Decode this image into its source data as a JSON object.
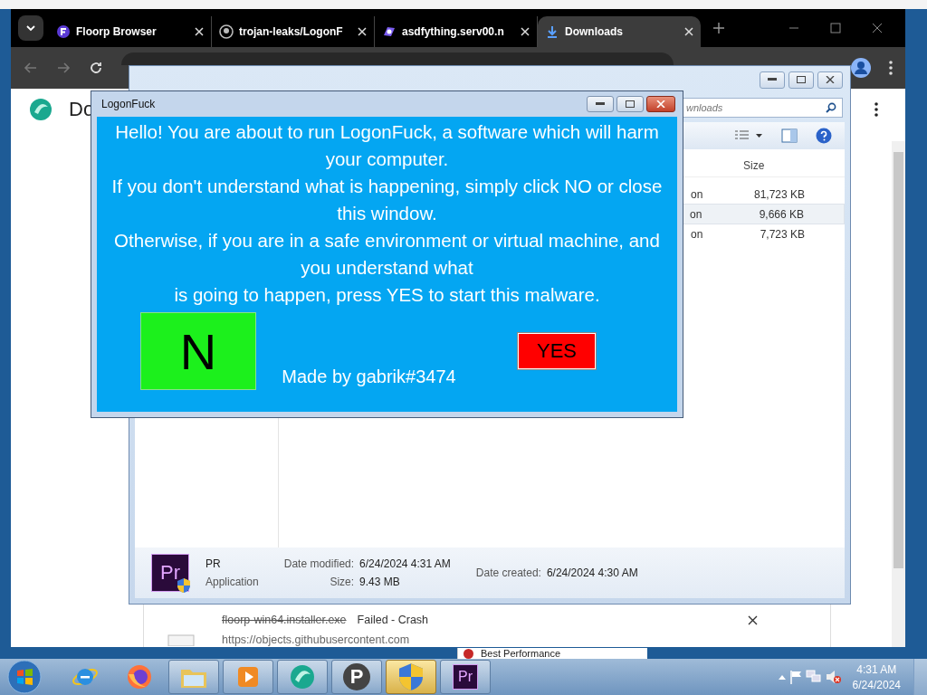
{
  "browser": {
    "tabs": [
      {
        "kind": "floorp",
        "label": "Floorp Browser",
        "selected": false
      },
      {
        "kind": "github",
        "label": "trojan-leaks/LogonF",
        "selected": false
      },
      {
        "kind": "site",
        "label": "asdfything.serv00.n",
        "selected": false
      },
      {
        "kind": "download",
        "label": "Downloads",
        "selected": true
      }
    ],
    "page": {
      "heading": "Do",
      "download": {
        "filename": "floorp-win64.installer.exe",
        "status": "Failed - Crash",
        "url": "https://objects.githubusercontent.com"
      },
      "popup": "Best Performance"
    }
  },
  "explorer": {
    "search": {
      "placeholder": "wnloads"
    },
    "size_header": "Size",
    "rows": [
      {
        "type": "on",
        "size": "81,723 KB",
        "selected": false
      },
      {
        "type": "on",
        "size": "9,666 KB",
        "selected": true
      },
      {
        "type": "on",
        "size": "7,723 KB",
        "selected": false
      }
    ],
    "details": {
      "icon_label": "Pr",
      "name": "PR",
      "type": "Application",
      "modified_label": "Date modified:",
      "modified": "6/24/2024 4:31 AM",
      "size_label": "Size:",
      "size": "9.43 MB",
      "created_label": "Date created:",
      "created": "6/24/2024 4:30 AM"
    }
  },
  "dialog": {
    "title": "LogonFuck",
    "lines": [
      "Hello! You are about to run LogonFuck, a software which will harm your computer.",
      "If you don't understand what is happening, simply click NO or close this window.",
      "Otherwise, if you are in a safe environment or virtual machine, and you understand what",
      "is going to happen, press YES to start this malware."
    ],
    "no_button": "N",
    "yes_button": "YES",
    "credit": "Made by gabrik#3474"
  },
  "taskbar": {
    "apps": [
      {
        "kind": "ie",
        "open": false,
        "selected": false
      },
      {
        "kind": "firefox",
        "open": false,
        "selected": false
      },
      {
        "kind": "folder",
        "open": true,
        "selected": false
      },
      {
        "kind": "media",
        "open": true,
        "selected": false
      },
      {
        "kind": "floorp",
        "open": true,
        "selected": false
      },
      {
        "kind": "psiphon",
        "label": "P",
        "open": true,
        "selected": false
      },
      {
        "kind": "shield",
        "open": true,
        "selected": true
      },
      {
        "kind": "premiere",
        "label": "Pr",
        "open": true,
        "selected": false
      }
    ],
    "time": "4:31 AM",
    "date": "6/24/2024"
  }
}
